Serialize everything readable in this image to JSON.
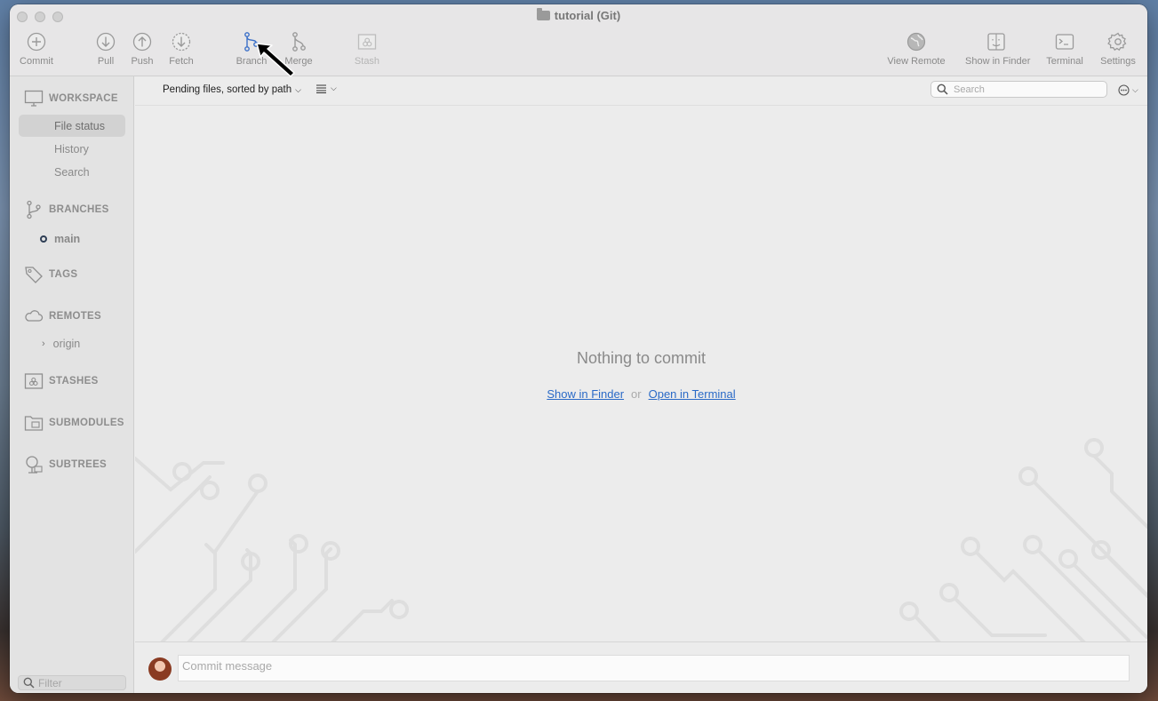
{
  "window": {
    "title": "tutorial (Git)"
  },
  "toolbar": {
    "commit": "Commit",
    "pull": "Pull",
    "push": "Push",
    "fetch": "Fetch",
    "branch": "Branch",
    "merge": "Merge",
    "stash": "Stash",
    "view_remote": "View Remote",
    "show_in_finder": "Show in Finder",
    "terminal": "Terminal",
    "settings": "Settings"
  },
  "sidebar": {
    "workspace": {
      "header": "WORKSPACE",
      "items": [
        "File status",
        "History",
        "Search"
      ],
      "selected": "File status"
    },
    "branches": {
      "header": "BRANCHES",
      "items": [
        "main"
      ]
    },
    "tags": {
      "header": "TAGS"
    },
    "remotes": {
      "header": "REMOTES",
      "items": [
        "origin"
      ]
    },
    "stashes": {
      "header": "STASHES"
    },
    "submodules": {
      "header": "SUBMODULES"
    },
    "subtrees": {
      "header": "SUBTREES"
    },
    "filter_placeholder": "Filter"
  },
  "main": {
    "sort_label": "Pending files, sorted by path",
    "search_placeholder": "Search",
    "empty_title": "Nothing to commit",
    "show_in_finder": "Show in Finder",
    "or": "or",
    "open_in_terminal": "Open in Terminal",
    "commit_placeholder": "Commit message"
  },
  "colors": {
    "accent": "#2a6ac7",
    "branch_icon": "#3a6fc8"
  },
  "icons": {
    "commit": "plus-circle-icon",
    "pull": "arrow-down-circle-icon",
    "push": "arrow-up-circle-icon",
    "fetch": "dashed-arrow-down-circle-icon",
    "branch": "branch-icon",
    "merge": "merge-icon",
    "stash": "stash-icon",
    "view_remote": "globe-icon",
    "finder": "finder-icon",
    "terminal": "terminal-icon",
    "settings": "gear-icon"
  }
}
